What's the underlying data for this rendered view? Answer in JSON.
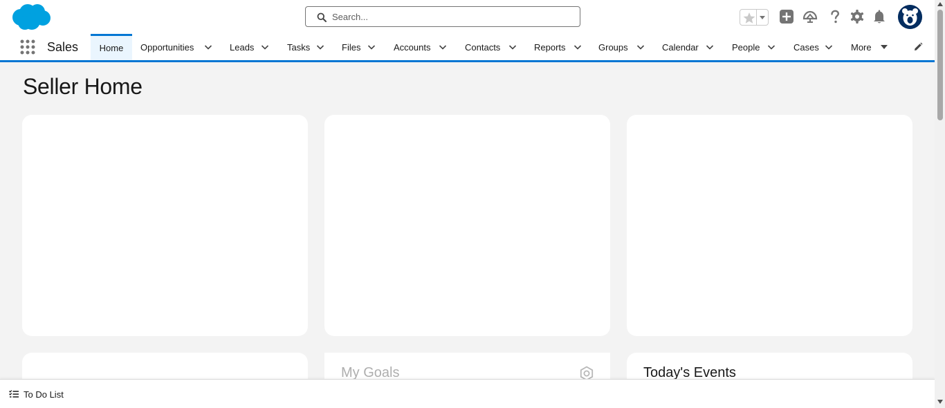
{
  "header": {
    "logo": "salesforce-cloud-logo",
    "search_placeholder": "Search...",
    "icons": [
      "star-icon",
      "chevron-down-icon",
      "plus-icon",
      "trailhead-icon",
      "help-icon",
      "gear-icon",
      "bell-icon",
      "avatar"
    ]
  },
  "nav": {
    "app_name": "Sales",
    "tabs": [
      {
        "label": "Home",
        "active": true
      },
      {
        "label": "Opportunities"
      },
      {
        "label": "Leads"
      },
      {
        "label": "Tasks"
      },
      {
        "label": "Files"
      },
      {
        "label": "Accounts"
      },
      {
        "label": "Contacts"
      },
      {
        "label": "Reports"
      },
      {
        "label": "Groups"
      },
      {
        "label": "Calendar"
      },
      {
        "label": "People"
      },
      {
        "label": "Cases"
      },
      {
        "label": "More"
      }
    ]
  },
  "main": {
    "page_title": "Seller Home",
    "cards": {
      "goals_title": "My Goals",
      "events_title": "Today's Events"
    }
  },
  "utility": {
    "todo_label": "To Do List"
  },
  "colors": {
    "brand_blue": "#0176d3",
    "logo_blue": "#00a1e0",
    "page_bg": "#f3f3f3",
    "icon_gray": "#747474"
  }
}
